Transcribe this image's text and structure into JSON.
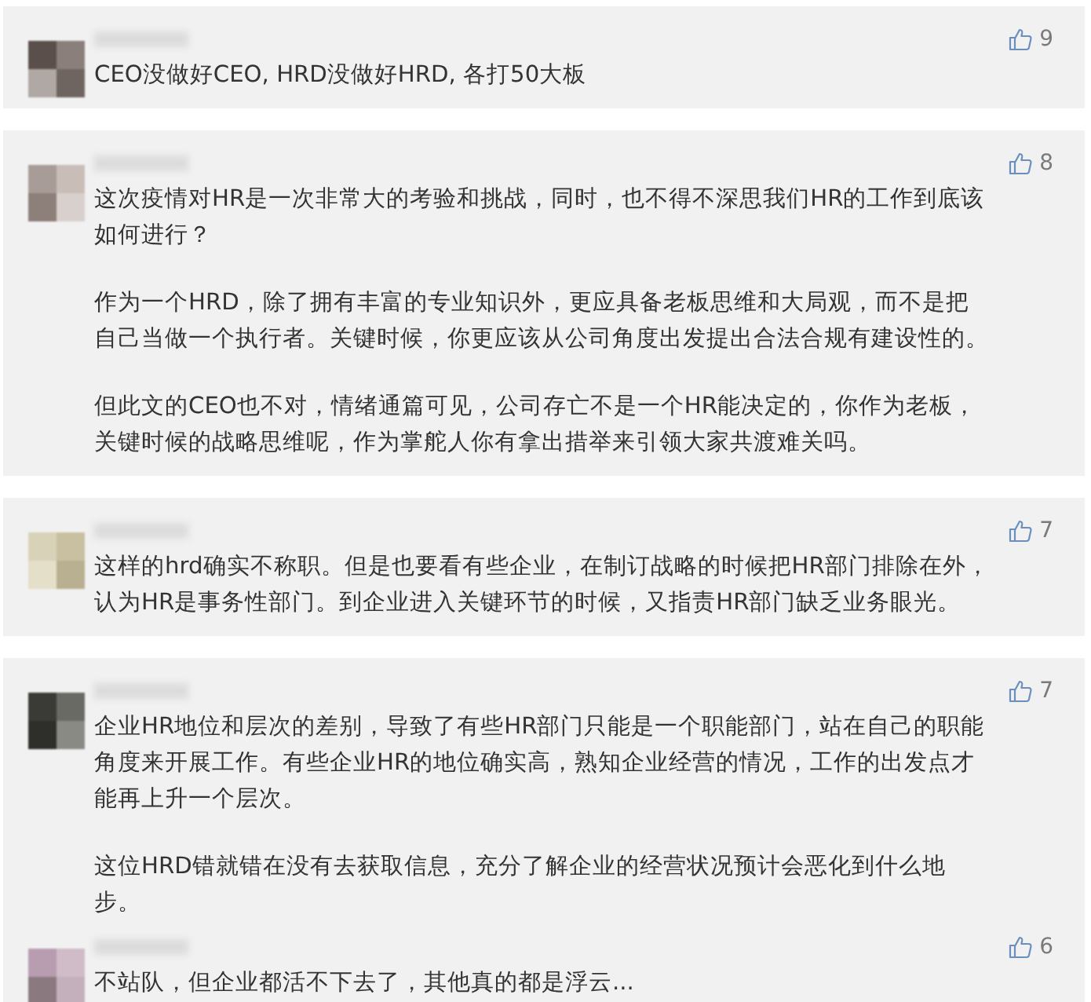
{
  "cards": [
    {
      "comments": [
        {
          "likes": "9",
          "paragraphs": [
            "CEO没做好CEO, HRD没做好HRD, 各打50大板"
          ]
        }
      ]
    },
    {
      "comments": [
        {
          "likes": "8",
          "paragraphs": [
            "这次疫情对HR是一次非常大的考验和挑战，同时，也不得不深思我们HR的工作到底该如何进行？",
            "作为一个HRD，除了拥有丰富的专业知识外，更应具备老板思维和大局观，而不是把自己当做一个执行者。关键时候，你更应该从公司角度出发提出合法合规有建设性的。",
            "但此文的CEO也不对，情绪通篇可见，公司存亡不是一个HR能决定的，你作为老板，关键时候的战略思维呢，作为掌舵人你有拿出措举来引领大家共渡难关吗。"
          ]
        }
      ]
    },
    {
      "comments": [
        {
          "likes": "7",
          "paragraphs": [
            "这样的hrd确实不称职。但是也要看有些企业，在制订战略的时候把HR部门排除在外，认为HR是事务性部门。到企业进入关键环节的时候，又指责HR部门缺乏业务眼光。"
          ]
        }
      ]
    },
    {
      "comments": [
        {
          "likes": "7",
          "paragraphs": [
            "企业HR地位和层次的差别，导致了有些HR部门只能是一个职能部门，站在自己的职能角度来开展工作。有些企业HR的地位确实高，熟知企业经营的情况，工作的出发点才能再上升一个层次。",
            "这位HRD错就错在没有去获取信息，充分了解企业的经营状况预计会恶化到什么地步。"
          ]
        },
        {
          "likes": "6",
          "paragraphs": [
            "不站队，但企业都活不下去了，其他真的都是浮云..."
          ]
        }
      ]
    }
  ]
}
